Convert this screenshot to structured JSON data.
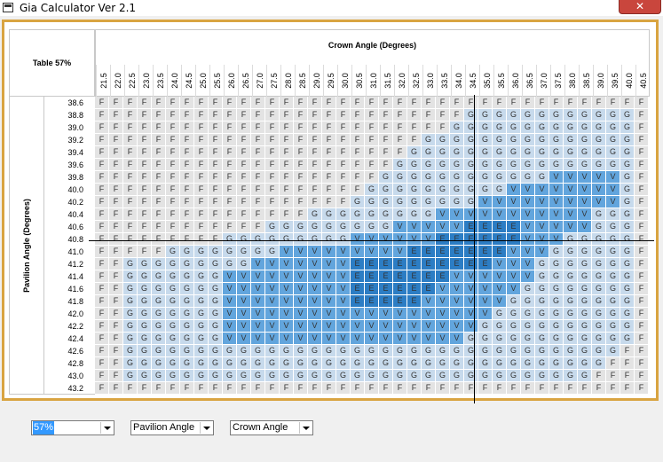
{
  "window": {
    "title": "Gia Calculator Ver 2.1",
    "close_label": "✕"
  },
  "grid": {
    "corner_label": "Table 57%",
    "column_title": "Crown Angle (Degrees)",
    "row_title": "Pavilion Angle (Degrees)",
    "crown_angles": [
      "21.5",
      "22.0",
      "22.5",
      "23.0",
      "23.5",
      "24.0",
      "24.5",
      "25.0",
      "25.5",
      "26.0",
      "26.5",
      "27.0",
      "27.5",
      "28.0",
      "28.5",
      "29.0",
      "29.5",
      "30.0",
      "30.5",
      "31.0",
      "31.5",
      "32.0",
      "32.5",
      "33.0",
      "33.5",
      "34.0",
      "34.5",
      "35.0",
      "35.5",
      "36.0",
      "36.5",
      "37.0",
      "37.5",
      "38.0",
      "38.5",
      "39.0",
      "39.5",
      "40.0",
      "40.5"
    ],
    "pavilion_angles": [
      "38.6",
      "38.8",
      "39.0",
      "39.2",
      "39.4",
      "39.6",
      "39.8",
      "40.0",
      "40.2",
      "40.4",
      "40.6",
      "40.8",
      "41.0",
      "41.2",
      "41.4",
      "41.6",
      "41.8",
      "42.0",
      "42.2",
      "42.4",
      "42.6",
      "42.8",
      "43.0",
      "43.2"
    ],
    "rows": [
      "FFFFFFFFFFFFFFFFFFFFFFFFFFFFFFFFFFFFFFF",
      "FFFFFFFFFFFFFFFFFFFFFFFFFFGGGGGGGGGGGGF",
      "FFFFFFFFFFFFFFFFFFFFFFFFFGGGGGGGGGGGGGF",
      "FFFFFFFFFFFFFFFFFFFFFFFGGGGGGGGGGGGGGGF",
      "FFFFFFFFFFFFFFFFFFFFFFGGGGGGGGGGGGGGGGF",
      "FFFFFFFFFFFFFFFFFFFFFGGGGGGGGGGGGGGGGGF",
      "FFFFFFFFFFFFFFFFFFFFGGGGGGGGGGGGVVVVVGF",
      "FFFFFFFFFFFFFFFFFFFGGGGGGGGGGVVVVVVVVGF",
      "FFFFFFFFFFFFFFFFFFGGGGGGGGGVVVVVVVVVVGF",
      "FFFFFFFFFFFFFFFGGGGGGGGGVVVVVVVVVVVGGGF",
      "FFFFFFFFFFFFGGGGGGGGGVVVVVEEEEVVVVVGGGF",
      "FFFFFFFFFGGGGGGGGGVVVVVVEEEEEEVVVGGGGGF",
      "FFFFFGGGGGGGGVVVVVVVVVEEEEEEEVVVGGGGGGF",
      "FFGGGGGGGGGVVVVVVVEEEEEEEEEEVVVGGGGGGGF",
      "FFGGGGGGGVVVVVVVVVEEEEEEEVVVVVVGGGGGGGF",
      "FFGGGGGGGVVVVVVVVVEEEEEEVVVVVVGGGGGGGGF",
      "FFGGGGGGGVVVVVVVVVEEEEEVVVVVVGGGGGGGGGF",
      "FFGGGGGGGVVVVVVVVVVVVVVVVVVVGGGGGGGGGGF",
      "FFGGGGGGGVVVVVVVVVVVVVVVVVVGGGGGGGGGGGF",
      "FFGGGGGGGVVVVVVVVVVVVVVVVVGGGGGGGGGGGGF",
      "FFGGGGGGGGGGGGGGGGGGGGGGGGGGGGGGGGGGGFF",
      "FFGGGGGGGGGGGGGGGGGGGGGGGGGGGGGGGGGGFFF",
      "FFGGGGGGGGGGGGGGGGGGGGGGGGGGGGGGGGGFFFF",
      "FFFFFFFFFFFFFFFFFFFFFFFFFFFFFFFFFFFFFFF"
    ],
    "colors": {
      "F": "#e3e3e3",
      "G": "#c7daec",
      "V": "#62a5dd",
      "E": "#2c7dc4"
    }
  },
  "controls": {
    "table_select": "57%",
    "pavilion_select": "Pavilion Angle",
    "crown_select": "Crown Angle"
  }
}
